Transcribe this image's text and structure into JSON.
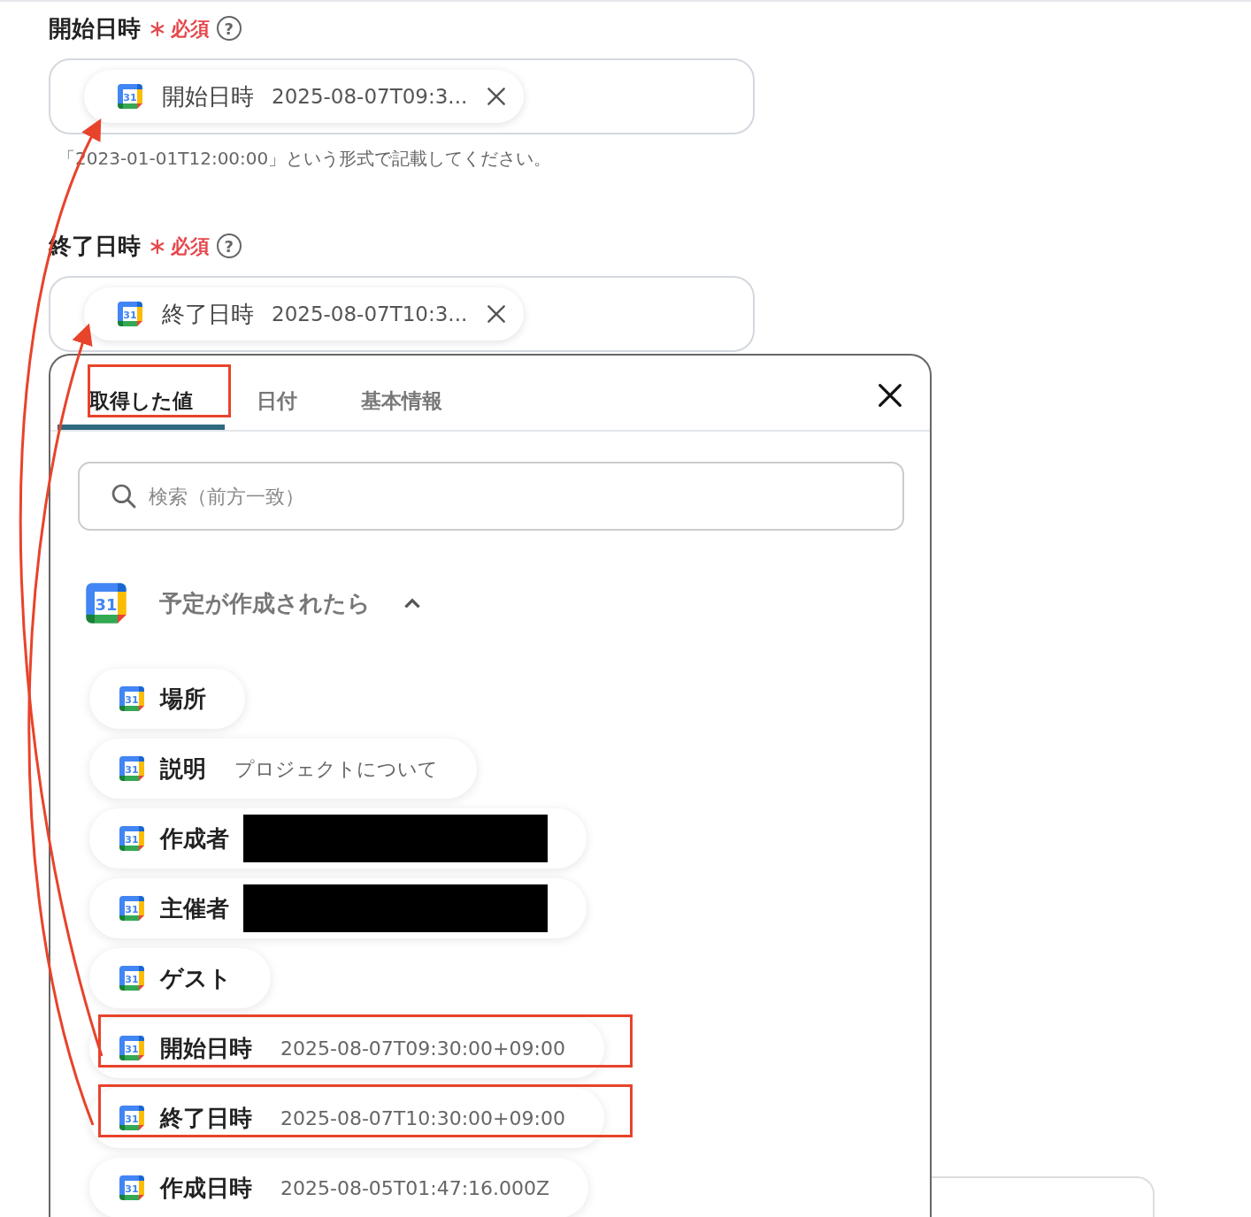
{
  "fields": [
    {
      "label": "開始日時",
      "required_mark": "∗",
      "required": "必須",
      "help": "?",
      "token": {
        "icon_text": "31",
        "name": "開始日時",
        "value": "2025-08-07T09:3..."
      },
      "hint": "「2023-01-01T12:00:00」という形式で記載してください。"
    },
    {
      "label": "終了日時",
      "required_mark": "∗",
      "required": "必須",
      "help": "?",
      "token": {
        "icon_text": "31",
        "name": "終了日時",
        "value": "2025-08-07T10:3..."
      }
    }
  ],
  "panel": {
    "tabs": [
      {
        "label": "取得した値",
        "selected": true,
        "highlighted": true
      },
      {
        "label": "日付",
        "selected": false,
        "highlighted": false
      },
      {
        "label": "基本情報",
        "selected": false,
        "highlighted": false
      }
    ],
    "search": {
      "placeholder": "検索（前方一致）"
    },
    "group": {
      "icon_text": "31",
      "title": "予定が作成されたら",
      "expanded": true,
      "items": [
        {
          "icon_text": "31",
          "name": "場所",
          "highlighted": false
        },
        {
          "icon_text": "31",
          "name": "説明",
          "value": "プロジェクトについて",
          "highlighted": false
        },
        {
          "icon_text": "31",
          "name": "作成者",
          "redacted": true,
          "highlighted": false
        },
        {
          "icon_text": "31",
          "name": "主催者",
          "redacted": true,
          "highlighted": false
        },
        {
          "icon_text": "31",
          "name": "ゲスト",
          "highlighted": false
        },
        {
          "icon_text": "31",
          "name": "開始日時",
          "value": "2025-08-07T09:30:00+09:00",
          "highlighted": true
        },
        {
          "icon_text": "31",
          "name": "終了日時",
          "value": "2025-08-07T10:30:00+09:00",
          "highlighted": true
        },
        {
          "icon_text": "31",
          "name": "作成日時",
          "value": "2025-08-05T01:47:16.000Z",
          "highlighted": false
        }
      ]
    }
  }
}
